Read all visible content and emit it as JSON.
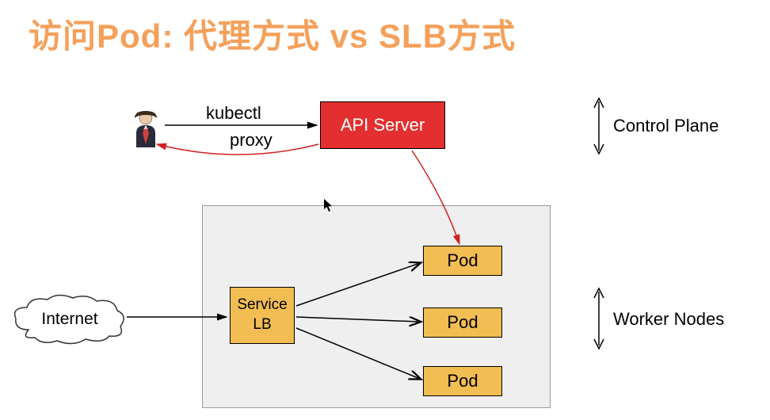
{
  "title": "访问Pod: 代理方式 vs SLB方式",
  "labels": {
    "kubectl": "kubectl",
    "proxy": "proxy",
    "apiServer": "API Server",
    "controlPlane": "Control Plane",
    "workerNodes": "Worker Nodes",
    "internet": "Internet",
    "serviceLine1": "Service",
    "serviceLine2": "LB",
    "pod1": "Pod",
    "pod2": "Pod",
    "pod3": "Pod"
  },
  "diagram": {
    "type": "architecture",
    "nodes": [
      {
        "id": "user",
        "kind": "actor",
        "label": "user"
      },
      {
        "id": "api-server",
        "kind": "component",
        "label": "API Server",
        "plane": "control"
      },
      {
        "id": "internet",
        "kind": "cloud",
        "label": "Internet"
      },
      {
        "id": "service-lb",
        "kind": "service",
        "label": "Service LB",
        "plane": "worker"
      },
      {
        "id": "pod1",
        "kind": "pod",
        "label": "Pod",
        "plane": "worker"
      },
      {
        "id": "pod2",
        "kind": "pod",
        "label": "Pod",
        "plane": "worker"
      },
      {
        "id": "pod3",
        "kind": "pod",
        "label": "Pod",
        "plane": "worker"
      }
    ],
    "edges": [
      {
        "from": "user",
        "to": "api-server",
        "label": "kubectl",
        "style": "black"
      },
      {
        "from": "api-server",
        "to": "user",
        "label": "proxy",
        "style": "red-curve"
      },
      {
        "from": "api-server",
        "to": "pod1",
        "style": "red-curve"
      },
      {
        "from": "internet",
        "to": "service-lb",
        "style": "black"
      },
      {
        "from": "service-lb",
        "to": "pod1",
        "style": "black"
      },
      {
        "from": "service-lb",
        "to": "pod2",
        "style": "black"
      },
      {
        "from": "service-lb",
        "to": "pod3",
        "style": "black"
      }
    ],
    "planes": [
      {
        "id": "control",
        "label": "Control Plane"
      },
      {
        "id": "worker",
        "label": "Worker Nodes"
      }
    ]
  }
}
